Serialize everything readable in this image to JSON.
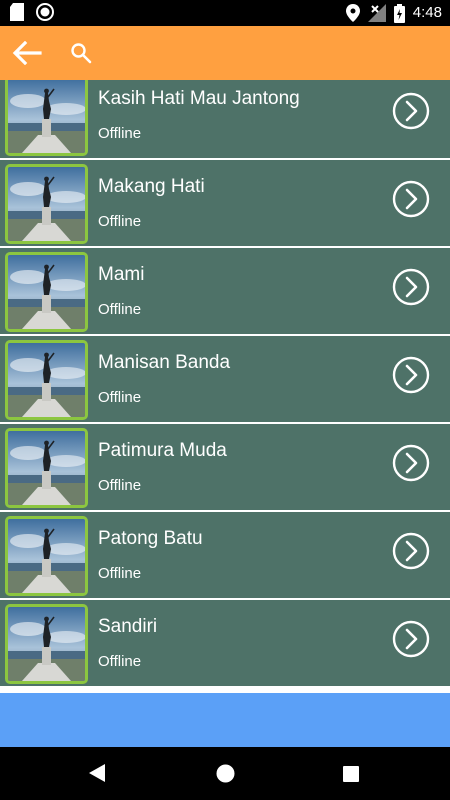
{
  "status_bar": {
    "time": "4:48",
    "icons": [
      "sd-card-icon",
      "circle-notification-icon",
      "location-icon",
      "no-signal-icon",
      "battery-charging-icon"
    ]
  },
  "toolbar": {
    "icons": [
      "arrow-back-icon",
      "search-icon"
    ],
    "color": "#FFA040"
  },
  "songs": [
    {
      "title": "Kasih Hati Mau Jantong",
      "status": "Offline"
    },
    {
      "title": "Makang Hati",
      "status": "Offline"
    },
    {
      "title": "Mami",
      "status": "Offline"
    },
    {
      "title": "Manisan Banda",
      "status": "Offline"
    },
    {
      "title": "Patimura Muda",
      "status": "Offline"
    },
    {
      "title": "Patong Batu",
      "status": "Offline"
    },
    {
      "title": "Sandiri",
      "status": "Offline"
    }
  ],
  "colors": {
    "row_background": "#4E7268",
    "thumb_border": "#8CC640",
    "ad_banner": "#5BA0F7"
  },
  "nav_bar": {
    "icons": [
      "nav-back-icon",
      "nav-home-icon",
      "nav-recents-icon"
    ]
  }
}
